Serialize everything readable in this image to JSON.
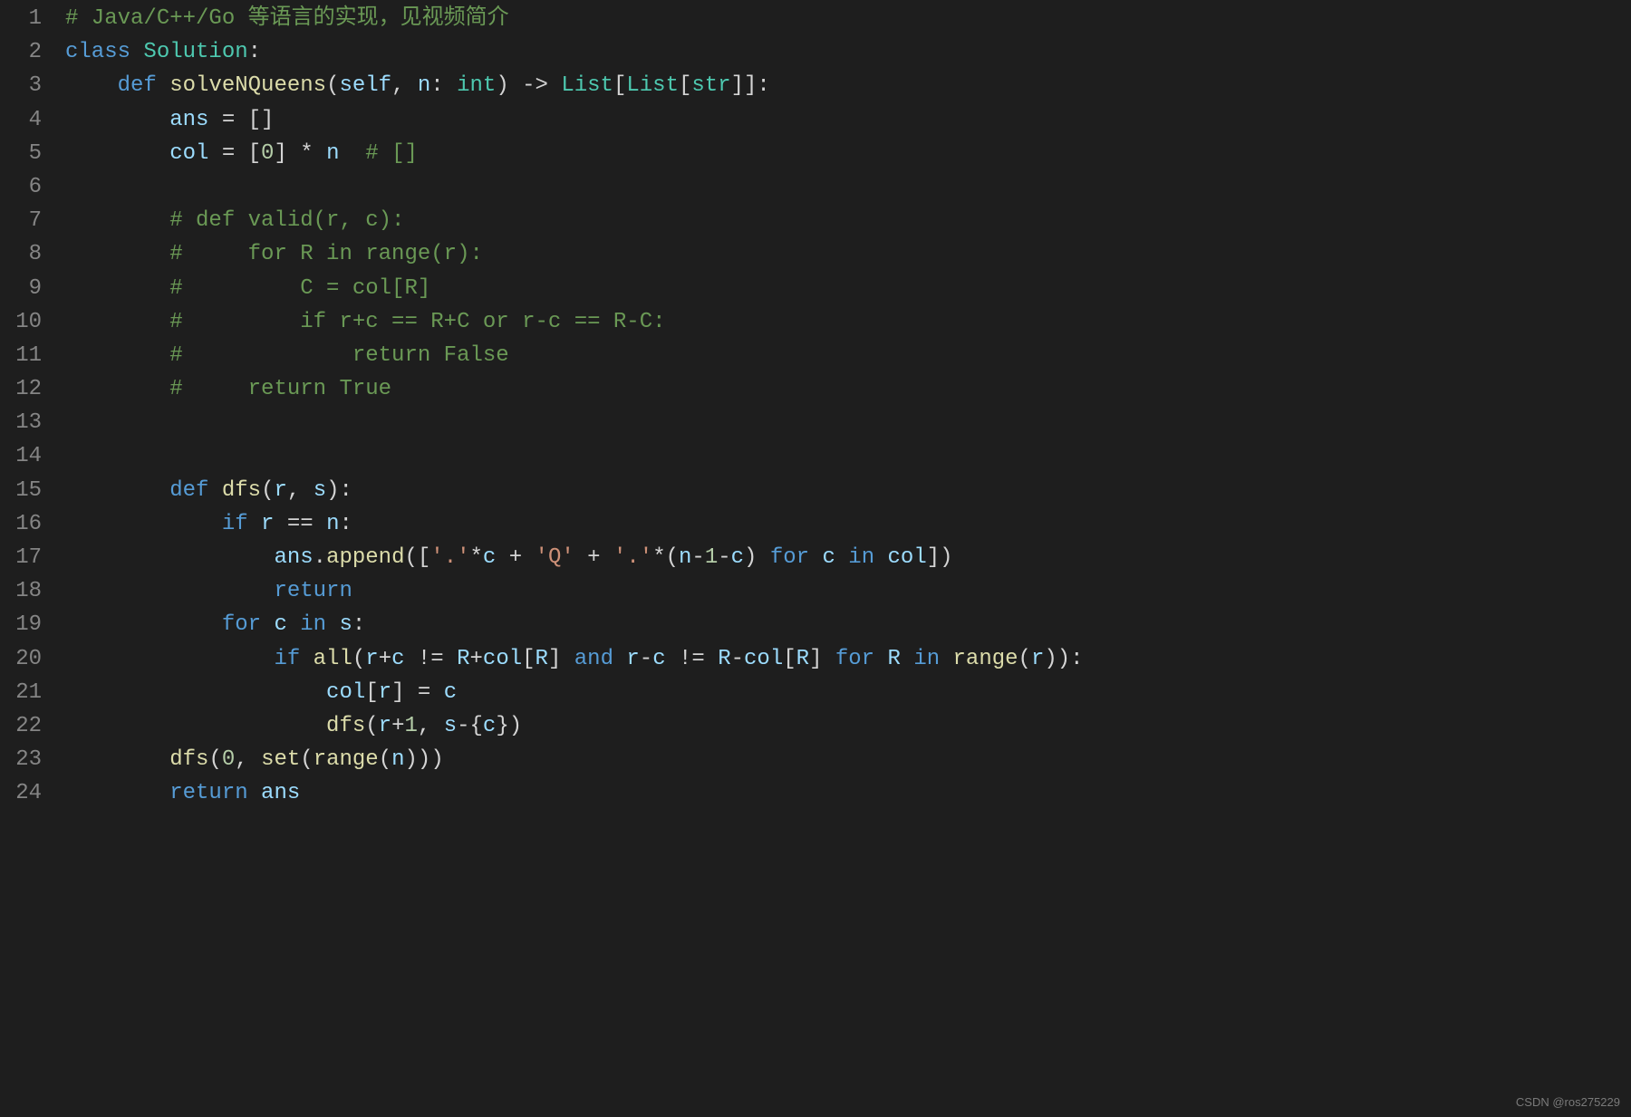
{
  "watermark": "CSDN @ros275229",
  "lines": [
    {
      "n": 1,
      "tokens": [
        {
          "cls": "c-comment",
          "t": "# Java/C++/Go 等语言的实现，见视频简介"
        }
      ]
    },
    {
      "n": 2,
      "tokens": [
        {
          "cls": "c-classkw",
          "t": "class"
        },
        {
          "cls": "c-text",
          "t": " "
        },
        {
          "cls": "c-classnm",
          "t": "Solution"
        },
        {
          "cls": "c-punct",
          "t": ":"
        }
      ]
    },
    {
      "n": 3,
      "tokens": [
        {
          "cls": "c-text",
          "t": "    "
        },
        {
          "cls": "c-defkw",
          "t": "def"
        },
        {
          "cls": "c-text",
          "t": " "
        },
        {
          "cls": "c-funcnm",
          "t": "solveNQueens"
        },
        {
          "cls": "c-punct",
          "t": "("
        },
        {
          "cls": "c-param",
          "t": "self"
        },
        {
          "cls": "c-punct",
          "t": ", "
        },
        {
          "cls": "c-param",
          "t": "n"
        },
        {
          "cls": "c-punct",
          "t": ": "
        },
        {
          "cls": "c-type",
          "t": "int"
        },
        {
          "cls": "c-punct",
          "t": ") -> "
        },
        {
          "cls": "c-type",
          "t": "List"
        },
        {
          "cls": "c-punct",
          "t": "["
        },
        {
          "cls": "c-type",
          "t": "List"
        },
        {
          "cls": "c-punct",
          "t": "["
        },
        {
          "cls": "c-type",
          "t": "str"
        },
        {
          "cls": "c-punct",
          "t": "]]:"
        }
      ]
    },
    {
      "n": 4,
      "tokens": [
        {
          "cls": "c-text",
          "t": "        "
        },
        {
          "cls": "c-var",
          "t": "ans"
        },
        {
          "cls": "c-punct",
          "t": " = []"
        }
      ]
    },
    {
      "n": 5,
      "tokens": [
        {
          "cls": "c-text",
          "t": "        "
        },
        {
          "cls": "c-var",
          "t": "col"
        },
        {
          "cls": "c-punct",
          "t": " = ["
        },
        {
          "cls": "c-num",
          "t": "0"
        },
        {
          "cls": "c-punct",
          "t": "] * "
        },
        {
          "cls": "c-var",
          "t": "n"
        },
        {
          "cls": "c-text",
          "t": "  "
        },
        {
          "cls": "c-comment",
          "t": "# []"
        }
      ]
    },
    {
      "n": 6,
      "tokens": [
        {
          "cls": "c-text",
          "t": ""
        }
      ]
    },
    {
      "n": 7,
      "tokens": [
        {
          "cls": "c-text",
          "t": "        "
        },
        {
          "cls": "c-comment",
          "t": "# def valid(r, c):"
        }
      ]
    },
    {
      "n": 8,
      "tokens": [
        {
          "cls": "c-text",
          "t": "        "
        },
        {
          "cls": "c-comment",
          "t": "#     for R in range(r):"
        }
      ]
    },
    {
      "n": 9,
      "tokens": [
        {
          "cls": "c-text",
          "t": "        "
        },
        {
          "cls": "c-comment",
          "t": "#         C = col[R]"
        }
      ]
    },
    {
      "n": 10,
      "tokens": [
        {
          "cls": "c-text",
          "t": "        "
        },
        {
          "cls": "c-comment",
          "t": "#         if r+c == R+C or r-c == R-C:"
        }
      ]
    },
    {
      "n": 11,
      "tokens": [
        {
          "cls": "c-text",
          "t": "        "
        },
        {
          "cls": "c-comment",
          "t": "#             return False"
        }
      ]
    },
    {
      "n": 12,
      "tokens": [
        {
          "cls": "c-text",
          "t": "        "
        },
        {
          "cls": "c-comment",
          "t": "#     return True"
        }
      ]
    },
    {
      "n": 13,
      "tokens": [
        {
          "cls": "c-text",
          "t": ""
        }
      ]
    },
    {
      "n": 14,
      "tokens": [
        {
          "cls": "c-text",
          "t": ""
        }
      ]
    },
    {
      "n": 15,
      "tokens": [
        {
          "cls": "c-text",
          "t": "        "
        },
        {
          "cls": "c-defkw",
          "t": "def"
        },
        {
          "cls": "c-text",
          "t": " "
        },
        {
          "cls": "c-funcnm",
          "t": "dfs"
        },
        {
          "cls": "c-punct",
          "t": "("
        },
        {
          "cls": "c-param",
          "t": "r"
        },
        {
          "cls": "c-punct",
          "t": ", "
        },
        {
          "cls": "c-param",
          "t": "s"
        },
        {
          "cls": "c-punct",
          "t": "):"
        }
      ]
    },
    {
      "n": 16,
      "tokens": [
        {
          "cls": "c-text",
          "t": "            "
        },
        {
          "cls": "c-keyword",
          "t": "if"
        },
        {
          "cls": "c-text",
          "t": " "
        },
        {
          "cls": "c-var",
          "t": "r"
        },
        {
          "cls": "c-punct",
          "t": " == "
        },
        {
          "cls": "c-var",
          "t": "n"
        },
        {
          "cls": "c-punct",
          "t": ":"
        }
      ]
    },
    {
      "n": 17,
      "tokens": [
        {
          "cls": "c-text",
          "t": "                "
        },
        {
          "cls": "c-var",
          "t": "ans"
        },
        {
          "cls": "c-punct",
          "t": "."
        },
        {
          "cls": "c-builtin",
          "t": "append"
        },
        {
          "cls": "c-punct",
          "t": "(["
        },
        {
          "cls": "c-str",
          "t": "'.'"
        },
        {
          "cls": "c-punct",
          "t": "*"
        },
        {
          "cls": "c-var",
          "t": "c"
        },
        {
          "cls": "c-punct",
          "t": " + "
        },
        {
          "cls": "c-str",
          "t": "'Q'"
        },
        {
          "cls": "c-punct",
          "t": " + "
        },
        {
          "cls": "c-str",
          "t": "'.'"
        },
        {
          "cls": "c-punct",
          "t": "*("
        },
        {
          "cls": "c-var",
          "t": "n"
        },
        {
          "cls": "c-punct",
          "t": "-"
        },
        {
          "cls": "c-num",
          "t": "1"
        },
        {
          "cls": "c-punct",
          "t": "-"
        },
        {
          "cls": "c-var",
          "t": "c"
        },
        {
          "cls": "c-punct",
          "t": ") "
        },
        {
          "cls": "c-keyword",
          "t": "for"
        },
        {
          "cls": "c-text",
          "t": " "
        },
        {
          "cls": "c-var",
          "t": "c"
        },
        {
          "cls": "c-text",
          "t": " "
        },
        {
          "cls": "c-keyword",
          "t": "in"
        },
        {
          "cls": "c-text",
          "t": " "
        },
        {
          "cls": "c-var",
          "t": "col"
        },
        {
          "cls": "c-punct",
          "t": "])"
        }
      ]
    },
    {
      "n": 18,
      "tokens": [
        {
          "cls": "c-text",
          "t": "                "
        },
        {
          "cls": "c-keyword",
          "t": "return"
        }
      ]
    },
    {
      "n": 19,
      "tokens": [
        {
          "cls": "c-text",
          "t": "            "
        },
        {
          "cls": "c-keyword",
          "t": "for"
        },
        {
          "cls": "c-text",
          "t": " "
        },
        {
          "cls": "c-var",
          "t": "c"
        },
        {
          "cls": "c-text",
          "t": " "
        },
        {
          "cls": "c-keyword",
          "t": "in"
        },
        {
          "cls": "c-text",
          "t": " "
        },
        {
          "cls": "c-var",
          "t": "s"
        },
        {
          "cls": "c-punct",
          "t": ":"
        }
      ]
    },
    {
      "n": 20,
      "tokens": [
        {
          "cls": "c-text",
          "t": "                "
        },
        {
          "cls": "c-keyword",
          "t": "if"
        },
        {
          "cls": "c-text",
          "t": " "
        },
        {
          "cls": "c-builtin",
          "t": "all"
        },
        {
          "cls": "c-punct",
          "t": "("
        },
        {
          "cls": "c-var",
          "t": "r"
        },
        {
          "cls": "c-punct",
          "t": "+"
        },
        {
          "cls": "c-var",
          "t": "c"
        },
        {
          "cls": "c-punct",
          "t": " != "
        },
        {
          "cls": "c-var",
          "t": "R"
        },
        {
          "cls": "c-punct",
          "t": "+"
        },
        {
          "cls": "c-var",
          "t": "col"
        },
        {
          "cls": "c-punct",
          "t": "["
        },
        {
          "cls": "c-var",
          "t": "R"
        },
        {
          "cls": "c-punct",
          "t": "] "
        },
        {
          "cls": "c-keyword",
          "t": "and"
        },
        {
          "cls": "c-text",
          "t": " "
        },
        {
          "cls": "c-var",
          "t": "r"
        },
        {
          "cls": "c-punct",
          "t": "-"
        },
        {
          "cls": "c-var",
          "t": "c"
        },
        {
          "cls": "c-punct",
          "t": " != "
        },
        {
          "cls": "c-var",
          "t": "R"
        },
        {
          "cls": "c-punct",
          "t": "-"
        },
        {
          "cls": "c-var",
          "t": "col"
        },
        {
          "cls": "c-punct",
          "t": "["
        },
        {
          "cls": "c-var",
          "t": "R"
        },
        {
          "cls": "c-punct",
          "t": "] "
        },
        {
          "cls": "c-keyword",
          "t": "for"
        },
        {
          "cls": "c-text",
          "t": " "
        },
        {
          "cls": "c-var",
          "t": "R"
        },
        {
          "cls": "c-text",
          "t": " "
        },
        {
          "cls": "c-keyword",
          "t": "in"
        },
        {
          "cls": "c-text",
          "t": " "
        },
        {
          "cls": "c-builtin",
          "t": "range"
        },
        {
          "cls": "c-punct",
          "t": "("
        },
        {
          "cls": "c-var",
          "t": "r"
        },
        {
          "cls": "c-punct",
          "t": ")):"
        }
      ]
    },
    {
      "n": 21,
      "tokens": [
        {
          "cls": "c-text",
          "t": "                    "
        },
        {
          "cls": "c-var",
          "t": "col"
        },
        {
          "cls": "c-punct",
          "t": "["
        },
        {
          "cls": "c-var",
          "t": "r"
        },
        {
          "cls": "c-punct",
          "t": "] = "
        },
        {
          "cls": "c-var",
          "t": "c"
        }
      ]
    },
    {
      "n": 22,
      "tokens": [
        {
          "cls": "c-text",
          "t": "                    "
        },
        {
          "cls": "c-funcnm",
          "t": "dfs"
        },
        {
          "cls": "c-punct",
          "t": "("
        },
        {
          "cls": "c-var",
          "t": "r"
        },
        {
          "cls": "c-punct",
          "t": "+"
        },
        {
          "cls": "c-num",
          "t": "1"
        },
        {
          "cls": "c-punct",
          "t": ", "
        },
        {
          "cls": "c-var",
          "t": "s"
        },
        {
          "cls": "c-punct",
          "t": "-{"
        },
        {
          "cls": "c-var",
          "t": "c"
        },
        {
          "cls": "c-punct",
          "t": "})"
        }
      ]
    },
    {
      "n": 23,
      "tokens": [
        {
          "cls": "c-text",
          "t": "        "
        },
        {
          "cls": "c-funcnm",
          "t": "dfs"
        },
        {
          "cls": "c-punct",
          "t": "("
        },
        {
          "cls": "c-num",
          "t": "0"
        },
        {
          "cls": "c-punct",
          "t": ", "
        },
        {
          "cls": "c-builtin",
          "t": "set"
        },
        {
          "cls": "c-punct",
          "t": "("
        },
        {
          "cls": "c-builtin",
          "t": "range"
        },
        {
          "cls": "c-punct",
          "t": "("
        },
        {
          "cls": "c-var",
          "t": "n"
        },
        {
          "cls": "c-punct",
          "t": ")))"
        }
      ]
    },
    {
      "n": 24,
      "tokens": [
        {
          "cls": "c-text",
          "t": "        "
        },
        {
          "cls": "c-keyword",
          "t": "return"
        },
        {
          "cls": "c-text",
          "t": " "
        },
        {
          "cls": "c-var",
          "t": "ans"
        }
      ]
    }
  ]
}
